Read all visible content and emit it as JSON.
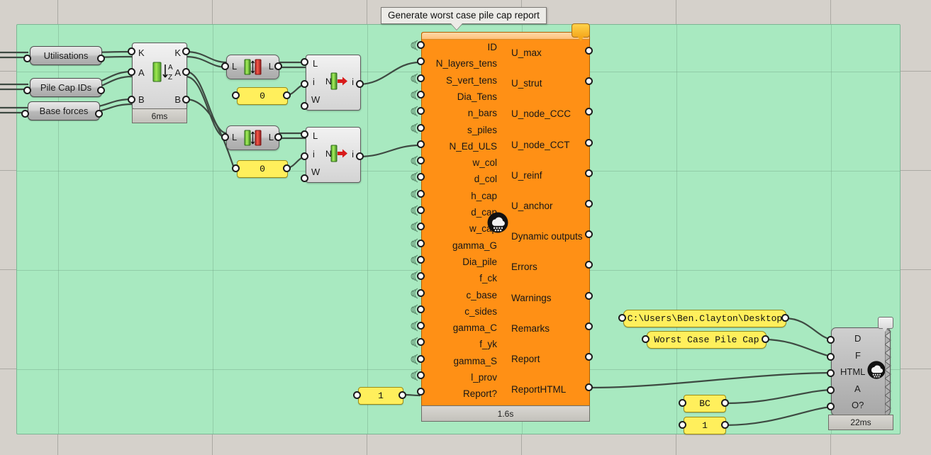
{
  "app": {
    "name": "Grasshopper canvas",
    "background_color": "#d5d1cb",
    "group_color": "#a8e9c0"
  },
  "tooltip": {
    "text": "Generate worst case pile cap report"
  },
  "params": [
    {
      "label": "Utilisations",
      "name": "param-utilisations"
    },
    {
      "label": "Pile Cap IDs",
      "name": "param-pile-cap-ids"
    },
    {
      "label": "Base forces",
      "name": "param-base-forces"
    }
  ],
  "sort_component": {
    "name": "sort-list-component",
    "inputs": [
      "K",
      "A",
      "B"
    ],
    "outputs": [
      "K",
      "A",
      "B"
    ],
    "timer": "6ms",
    "icon": "sort-az-icon"
  },
  "length_components": [
    {
      "name": "list-length-top",
      "input": "L",
      "output": "L",
      "icon": "list-length-icon"
    },
    {
      "name": "list-length-bottom",
      "input": "L",
      "output": "L",
      "icon": "list-length-icon"
    }
  ],
  "item_components": [
    {
      "name": "list-item-top",
      "inputs": [
        "L",
        "i",
        "W"
      ],
      "outputs": [
        "i"
      ],
      "icon": "list-item-icon"
    },
    {
      "name": "list-item-bottom",
      "inputs": [
        "L",
        "i",
        "W"
      ],
      "outputs": [
        "i"
      ],
      "icon": "list-item-icon"
    }
  ],
  "index_panels": [
    {
      "name": "index-panel-top",
      "value": "0"
    },
    {
      "name": "index-panel-bottom",
      "value": "0"
    }
  ],
  "report_toggle_panel": {
    "name": "report-flag-panel",
    "value": "1"
  },
  "main_component": {
    "name": "pile-cap-report-component",
    "color": "#ff9015",
    "timer": "1.6s",
    "balloon_icon": "message-balloon-icon",
    "cloud_icon": "cloud-compute-icon",
    "inputs": [
      "ID",
      "N_layers_tens",
      "S_vert_tens",
      "Dia_Tens",
      "n_bars",
      "s_piles",
      "N_Ed_ULS",
      "w_col",
      "d_col",
      "h_cap",
      "d_cap",
      "w_cap",
      "gamma_G",
      "Dia_pile",
      "f_ck",
      "c_base",
      "c_sides",
      "gamma_C",
      "f_yk",
      "gamma_S",
      "l_prov",
      "Report?"
    ],
    "outputs": [
      "U_max",
      "U_strut",
      "U_node_CCC",
      "U_node_CCT",
      "U_reinf",
      "U_anchor",
      "Dynamic outputs",
      "Errors",
      "Warnings",
      "Remarks",
      "Report",
      "ReportHTML"
    ]
  },
  "path_panels": [
    {
      "name": "folder-path-panel",
      "value": "C:\\Users\\Ben.Clayton\\Desktop"
    },
    {
      "name": "file-name-panel",
      "value": "Worst Case Pile Cap"
    }
  ],
  "small_panels": [
    {
      "name": "bc-panel",
      "value": "BC"
    },
    {
      "name": "overwrite-panel",
      "value": "1"
    }
  ],
  "writer_component": {
    "name": "html-file-writer-component",
    "inputs": [
      "D",
      "F",
      "HTML",
      "A",
      "O?"
    ],
    "timer": "22ms",
    "icon": "cloud-compute-icon",
    "control_icon": "control-toggle-icon"
  }
}
